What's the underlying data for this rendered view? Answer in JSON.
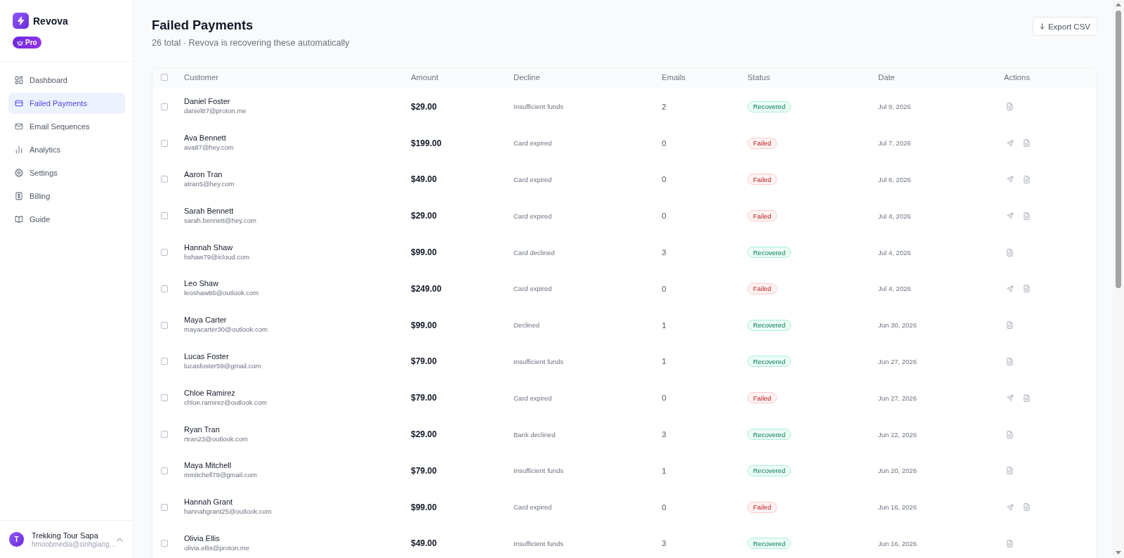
{
  "sidebar": {
    "brand": "Revova",
    "plan_badge": "Pro",
    "nav": [
      {
        "label": "Dashboard",
        "kind": "dashboard",
        "selected": false
      },
      {
        "label": "Failed Payments",
        "kind": "payments",
        "selected": true
      },
      {
        "label": "Email Sequences",
        "kind": "emails",
        "selected": false
      },
      {
        "label": "Analytics",
        "kind": "analytics",
        "selected": false
      },
      {
        "label": "Settings",
        "kind": "settings",
        "selected": false
      },
      {
        "label": "Billing",
        "kind": "billing",
        "selected": false
      },
      {
        "label": "Guide",
        "kind": "guide",
        "selected": false
      }
    ],
    "account": {
      "initial": "T",
      "name": "Trekking Tour Sapa",
      "email": "hmoobmedia@sinhgiang…"
    }
  },
  "page_header": {
    "title": "Failed Payments",
    "subtitle": "26 total · Revova is recovering these automatically",
    "export_button": "Export CSV"
  },
  "table": {
    "all_selected": false,
    "columns": [
      "Customer",
      "Amount",
      "Decline",
      "Emails",
      "Status",
      "Date",
      "Actions"
    ],
    "rows": [
      {
        "selected": false,
        "customer": "Daniel Foster",
        "email": "daniel87@proton.me",
        "amount": "$29.00",
        "decline": "Insufficient funds",
        "emails": "2",
        "status": {
          "label": "Recovered",
          "kind": "recovered"
        },
        "date": "Jul 9, 2026",
        "retry_available": false
      },
      {
        "selected": false,
        "customer": "Ava Bennett",
        "email": "ava87@hey.com",
        "amount": "$199.00",
        "decline": "Card expired",
        "emails": "0",
        "status": {
          "label": "Failed",
          "kind": "failed"
        },
        "date": "Jul 7, 2026",
        "retry_available": true
      },
      {
        "selected": false,
        "customer": "Aaron Tran",
        "email": "atran5@hey.com",
        "amount": "$49.00",
        "decline": "Card expired",
        "emails": "0",
        "status": {
          "label": "Failed",
          "kind": "failed"
        },
        "date": "Jul 6, 2026",
        "retry_available": true
      },
      {
        "selected": false,
        "customer": "Sarah Bennett",
        "email": "sarah.bennett@hey.com",
        "amount": "$29.00",
        "decline": "Card expired",
        "emails": "0",
        "status": {
          "label": "Failed",
          "kind": "failed"
        },
        "date": "Jul 4, 2026",
        "retry_available": true
      },
      {
        "selected": false,
        "customer": "Hannah Shaw",
        "email": "hshaw79@icloud.com",
        "amount": "$99.00",
        "decline": "Card declined",
        "emails": "3",
        "status": {
          "label": "Recovered",
          "kind": "recovered"
        },
        "date": "Jul 4, 2026",
        "retry_available": false
      },
      {
        "selected": false,
        "customer": "Leo Shaw",
        "email": "leoshaw86@outlook.com",
        "amount": "$249.00",
        "decline": "Card expired",
        "emails": "0",
        "status": {
          "label": "Failed",
          "kind": "failed"
        },
        "date": "Jul 4, 2026",
        "retry_available": true
      },
      {
        "selected": false,
        "customer": "Maya Carter",
        "email": "mayacarter30@outlook.com",
        "amount": "$99.00",
        "decline": "Declined",
        "emails": "1",
        "status": {
          "label": "Recovered",
          "kind": "recovered"
        },
        "date": "Jun 30, 2026",
        "retry_available": false
      },
      {
        "selected": false,
        "customer": "Lucas Foster",
        "email": "lucasfoster59@gmail.com",
        "amount": "$79.00",
        "decline": "Insufficient funds",
        "emails": "1",
        "status": {
          "label": "Recovered",
          "kind": "recovered"
        },
        "date": "Jun 27, 2026",
        "retry_available": false
      },
      {
        "selected": false,
        "customer": "Chloe Ramirez",
        "email": "chloe.ramirez@outlook.com",
        "amount": "$79.00",
        "decline": "Card expired",
        "emails": "0",
        "status": {
          "label": "Failed",
          "kind": "failed"
        },
        "date": "Jun 27, 2026",
        "retry_available": true
      },
      {
        "selected": false,
        "customer": "Ryan Tran",
        "email": "rtran23@outlook.com",
        "amount": "$29.00",
        "decline": "Bank declined",
        "emails": "3",
        "status": {
          "label": "Recovered",
          "kind": "recovered"
        },
        "date": "Jun 22, 2026",
        "retry_available": false
      },
      {
        "selected": false,
        "customer": "Maya Mitchell",
        "email": "mmitchell79@gmail.com",
        "amount": "$79.00",
        "decline": "Insufficient funds",
        "emails": "1",
        "status": {
          "label": "Recovered",
          "kind": "recovered"
        },
        "date": "Jun 20, 2026",
        "retry_available": false
      },
      {
        "selected": false,
        "customer": "Hannah Grant",
        "email": "hannahgrant25@outlook.com",
        "amount": "$99.00",
        "decline": "Card expired",
        "emails": "0",
        "status": {
          "label": "Failed",
          "kind": "failed"
        },
        "date": "Jun 16, 2026",
        "retry_available": true
      },
      {
        "selected": false,
        "customer": "Olivia Ellis",
        "email": "olivia.ellis@proton.me",
        "amount": "$49.00",
        "decline": "Insufficient funds",
        "emails": "3",
        "status": {
          "label": "Recovered",
          "kind": "recovered"
        },
        "date": "Jun 16, 2026",
        "retry_available": false
      }
    ]
  }
}
